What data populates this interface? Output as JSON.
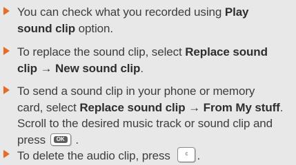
{
  "items": [
    {
      "line1_text": "You can check what you recorded using ",
      "line1_bold": "Play",
      "line2_bold": "sound clip",
      "line2_text": " option."
    },
    {
      "line1_text": "To replace the sound clip, select ",
      "line1_bold": "Replace sound",
      "line2_bold": "clip",
      "line2_arrow": " → ",
      "line2_bold2": "New sound clip",
      "line2_end": "."
    },
    {
      "line1_text": "To send a sound clip in your phone or memory",
      "line2_text": "card, select ",
      "line2_bold": "Replace sound clip",
      "line2_arrow": " → ",
      "line2_bold2": "From My stuff",
      "line2_end": ".",
      "line3_text": "Scroll to the desired music track or sound clip and",
      "line4_text": "press ",
      "line4_key": "OK",
      "line4_end": " ."
    },
    {
      "line1_text": "To delete the audio clip, press ",
      "line1_key": "c",
      "line1_end": "."
    }
  ],
  "icons": {
    "bullet": "triangle-bullet-icon",
    "ok_key": "ok-key-icon",
    "clear_key": "clear-key-icon"
  },
  "colors": {
    "bullet": "#e96a24",
    "background": "#e8e8e8",
    "text": "#3d3d3d"
  }
}
